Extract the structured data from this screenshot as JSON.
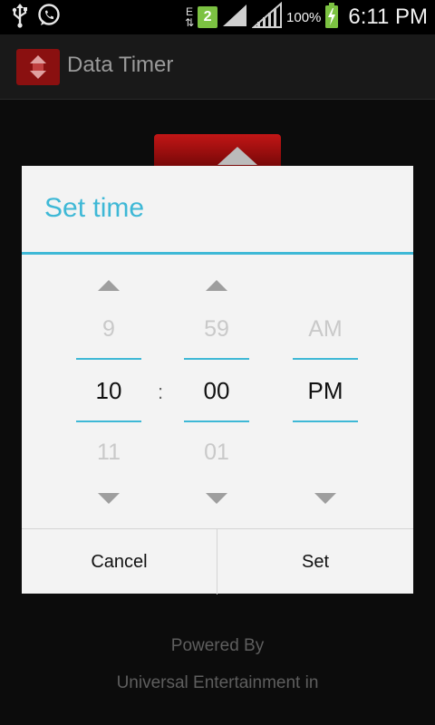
{
  "status_bar": {
    "time": "6:11 PM",
    "battery_pct": "100%",
    "network_letter": "E",
    "sim_badge": "2",
    "icons": [
      "usb-icon",
      "whatsapp-icon",
      "data-arrows-icon",
      "signal-icon",
      "signal-icon",
      "battery-charging-icon"
    ]
  },
  "app": {
    "title": "Data Timer"
  },
  "background": {
    "powered_by": "Powered By",
    "company": "Universal Entertainment in"
  },
  "dialog": {
    "title": "Set time",
    "separator": ":",
    "hour": {
      "prev": "9",
      "current": "10",
      "next": "11"
    },
    "minute": {
      "prev": "59",
      "current": "00",
      "next": "01"
    },
    "ampm": {
      "prev": "AM",
      "current": "PM",
      "next": ""
    },
    "cancel_label": "Cancel",
    "set_label": "Set"
  },
  "colors": {
    "accent": "#3eb8d6",
    "dialog_bg": "#f3f3f3",
    "app_icon_red": "#8a1010"
  }
}
